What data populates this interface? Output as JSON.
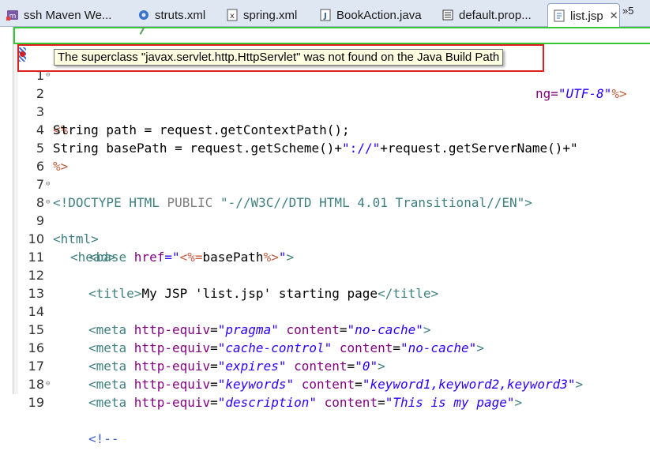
{
  "tabs": [
    {
      "label": "ssh Maven We...",
      "icon": "maven-project-icon",
      "active": false,
      "close": ""
    },
    {
      "label": "struts.xml",
      "icon": "gear-xml-icon",
      "active": false,
      "close": ""
    },
    {
      "label": "spring.xml",
      "icon": "xml-file-icon",
      "active": false,
      "close": ""
    },
    {
      "label": "BookAction.java",
      "icon": "java-file-icon",
      "active": false,
      "close": ""
    },
    {
      "label": "default.prop...",
      "icon": "properties-file-icon",
      "active": false,
      "close": ""
    },
    {
      "label": "list.jsp",
      "icon": "jsp-file-icon",
      "active": true,
      "close": "✕"
    }
  ],
  "tab_overflow": "»5",
  "tooltip": "The superclass \"javax.servlet.http.HttpServlet\" was not found on the Java Build Path",
  "line1_tail": {
    "attr": "ng=",
    "value": "\"UTF-8\"",
    "close": "%>"
  },
  "lines": [
    {
      "n": "1",
      "fold": ""
    },
    {
      "n": "2",
      "fold": "⊖"
    },
    {
      "n": "3",
      "fold": ""
    },
    {
      "n": "4",
      "fold": ""
    },
    {
      "n": "5",
      "fold": ""
    },
    {
      "n": "6",
      "fold": ""
    },
    {
      "n": "7",
      "fold": ""
    },
    {
      "n": "8",
      "fold": "⊖"
    },
    {
      "n": "9",
      "fold": "⊖"
    },
    {
      "n": "10",
      "fold": ""
    },
    {
      "n": "11",
      "fold": ""
    },
    {
      "n": "12",
      "fold": ""
    },
    {
      "n": "13",
      "fold": ""
    },
    {
      "n": "14",
      "fold": ""
    },
    {
      "n": "15",
      "fold": ""
    },
    {
      "n": "16",
      "fold": ""
    },
    {
      "n": "17",
      "fold": ""
    },
    {
      "n": "18",
      "fold": ""
    },
    {
      "n": "19",
      "fold": "⊖"
    }
  ],
  "code": {
    "l2": "<%",
    "l3": "String path = request.getContextPath();",
    "l4a": "String basePath = request.getScheme()+",
    "l4b": "\"://\"",
    "l4c": "+request.getServerName()+\"",
    "l5": "%>",
    "l7a": "<!DOCTYPE ",
    "l7b": "HTML ",
    "l7c": "PUBLIC ",
    "l7d": "\"-//W3C//DTD HTML 4.01 Transitional//EN\"",
    "l7e": ">",
    "l8": "<html>",
    "l9": "<head>",
    "l10a": "<base ",
    "l10b": "href",
    "l10c": "=\"",
    "l10d": "<%=",
    "l10e": "basePath",
    "l10f": "%>",
    "l10g": "\"",
    "l10h": ">",
    "l12a": "<title>",
    "l12b": "My JSP 'list.jsp' starting page",
    "l12c": "</title>",
    "meta": [
      {
        "equiv": "\"pragma\"",
        "content": "\"no-cache\""
      },
      {
        "equiv": "\"cache-control\"",
        "content": "\"no-cache\""
      },
      {
        "equiv": "\"expires\"",
        "content": "\"0\""
      },
      {
        "equiv": "\"keywords\"",
        "content": "\"keyword1,keyword2,keyword3\""
      },
      {
        "equiv": "\"description\"",
        "content": "\"This is my page\""
      }
    ],
    "meta_open": "<meta ",
    "meta_equiv_attr": "http-equiv",
    "meta_eq": "=",
    "meta_content_attr": "content",
    "meta_close": ">",
    "l19": "<!--"
  },
  "colors": {
    "tag": "#3f7f7f",
    "attribute": "#7f007f",
    "string": "#2a00ff",
    "jsp_delimiter": "#bf5f3f",
    "error_box": "#e02020",
    "ruler_border": "#37c837",
    "tooltip_bg": "#ffffe1"
  }
}
